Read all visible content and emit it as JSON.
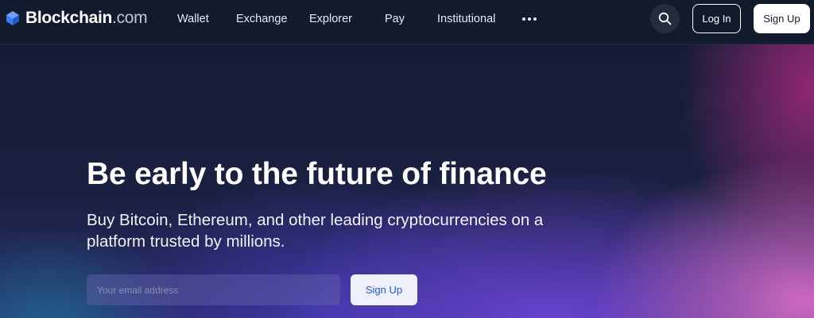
{
  "header": {
    "logo_text": "Blockchain",
    "logo_suffix": ".com",
    "nav": {
      "wallet": "Wallet",
      "exchange": "Exchange",
      "explorer": "Explorer",
      "pay": "Pay",
      "institutional": "Institutional"
    },
    "more_icon": "more-horizontal-icon",
    "search_icon": "search-icon",
    "login_label": "Log In",
    "signup_label": "Sign Up"
  },
  "hero": {
    "title": "Be early to the future of finance",
    "subtitle": "Buy Bitcoin, Ethereum, and other leading cryptocurrencies on a platform trusted by millions.",
    "email_placeholder": "Your email address",
    "signup_label": "Sign Up"
  },
  "colors": {
    "header_bg": "#121a2e",
    "logo_blue": "#3d7bf5",
    "signup_text_blue": "#2256d8"
  }
}
